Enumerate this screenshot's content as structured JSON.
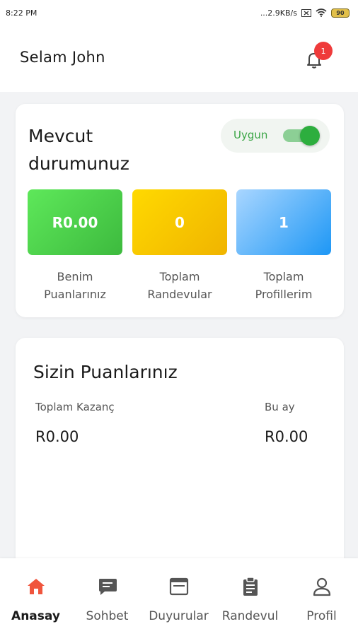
{
  "status_bar": {
    "time": "8:22 PM",
    "network_speed": "...2.9KB/s",
    "battery": "90",
    "icons": [
      "close-box-icon",
      "wifi-icon",
      "battery-icon"
    ]
  },
  "header": {
    "greeting": "Selam John",
    "notification_count": "1",
    "icon": "bell-icon"
  },
  "status_card": {
    "title": "Mevcut durumunuz",
    "toggle_label": "Uygun",
    "toggle_on": true,
    "tiles": [
      {
        "value": "R0.00",
        "caption": "Benim Puanlarınız",
        "color": "#4cd04a"
      },
      {
        "value": "0",
        "caption": "Toplam Randevular",
        "color": "#f7c600"
      },
      {
        "value": "1",
        "caption": "Toplam Profillerim",
        "color": "#3aa7f8"
      }
    ]
  },
  "points_card": {
    "title": "Sizin Puanlarınız",
    "total_label": "Toplam Kazanç",
    "total_value": "R0.00",
    "month_label": "Bu ay",
    "month_value": "R0.00"
  },
  "bottom_nav": {
    "items": [
      {
        "label": "Anasay",
        "icon": "home-icon",
        "active": true
      },
      {
        "label": "Sohbet",
        "icon": "chat-icon",
        "active": false
      },
      {
        "label": "Duyurular",
        "icon": "announcements-icon",
        "active": false
      },
      {
        "label": "Randevul",
        "icon": "clipboard-icon",
        "active": false
      },
      {
        "label": "Profil",
        "icon": "profile-icon",
        "active": false
      }
    ]
  },
  "colors": {
    "accent_green": "#2dae3e",
    "badge_red": "#ef3b3b",
    "nav_active": "#f0553d"
  }
}
